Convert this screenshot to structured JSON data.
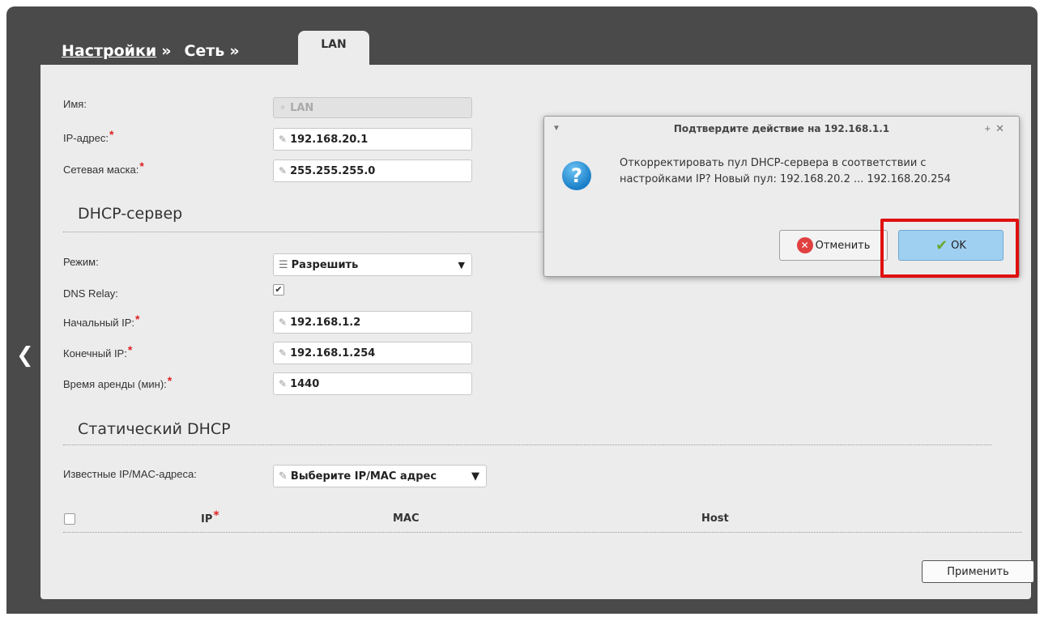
{
  "breadcrumbs": {
    "settings": "Настройки",
    "sep": "»",
    "network": "Сеть",
    "tab": "LAN"
  },
  "lan": {
    "name_label": "Имя:",
    "name_value": "LAN",
    "ip_label": "IP-адрес:",
    "ip_value": "192.168.20.1",
    "mask_label": "Сетевая маска:",
    "mask_value": "255.255.255.0",
    "required_mark": "*"
  },
  "dhcp": {
    "title": "DHCP-сервер",
    "mode_label": "Режим:",
    "mode_value": "Разрешить",
    "dns_relay_label": "DNS Relay:",
    "dns_relay_checked": true,
    "start_ip_label": "Начальный IP:",
    "start_ip_value": "192.168.1.2",
    "end_ip_label": "Конечный IP:",
    "end_ip_value": "192.168.1.254",
    "lease_label": "Время аренды (мин):",
    "lease_value": "1440"
  },
  "static_dhcp": {
    "title": "Статический DHCP",
    "known_label": "Известные IP/MAC-адреса:",
    "known_select": "Выберите IP/MAC адрес",
    "columns": [
      "IP",
      "MAC",
      "Host"
    ]
  },
  "apply_label": "Применить",
  "dialog": {
    "title": "Подтвердите действие на 192.168.1.1",
    "message_line1": "Откорректировать пул DHCP-сервера в соответствии с",
    "message_line2": "настройками IP? Новый пул: 192.168.20.2 ... 192.168.20.254",
    "cancel_label": "Отменить",
    "ok_label": "OK"
  },
  "colors": {
    "frame": "#4a4a4a",
    "panel": "#ececec",
    "required": "#dd2222",
    "highlight": "#e01010",
    "ok_button": "#9fd0f2"
  },
  "icons": [
    "chevron-left-icon",
    "pencil-icon",
    "lock-icon",
    "list-icon",
    "question-icon",
    "cancel-x-icon",
    "checkmark-icon"
  ]
}
